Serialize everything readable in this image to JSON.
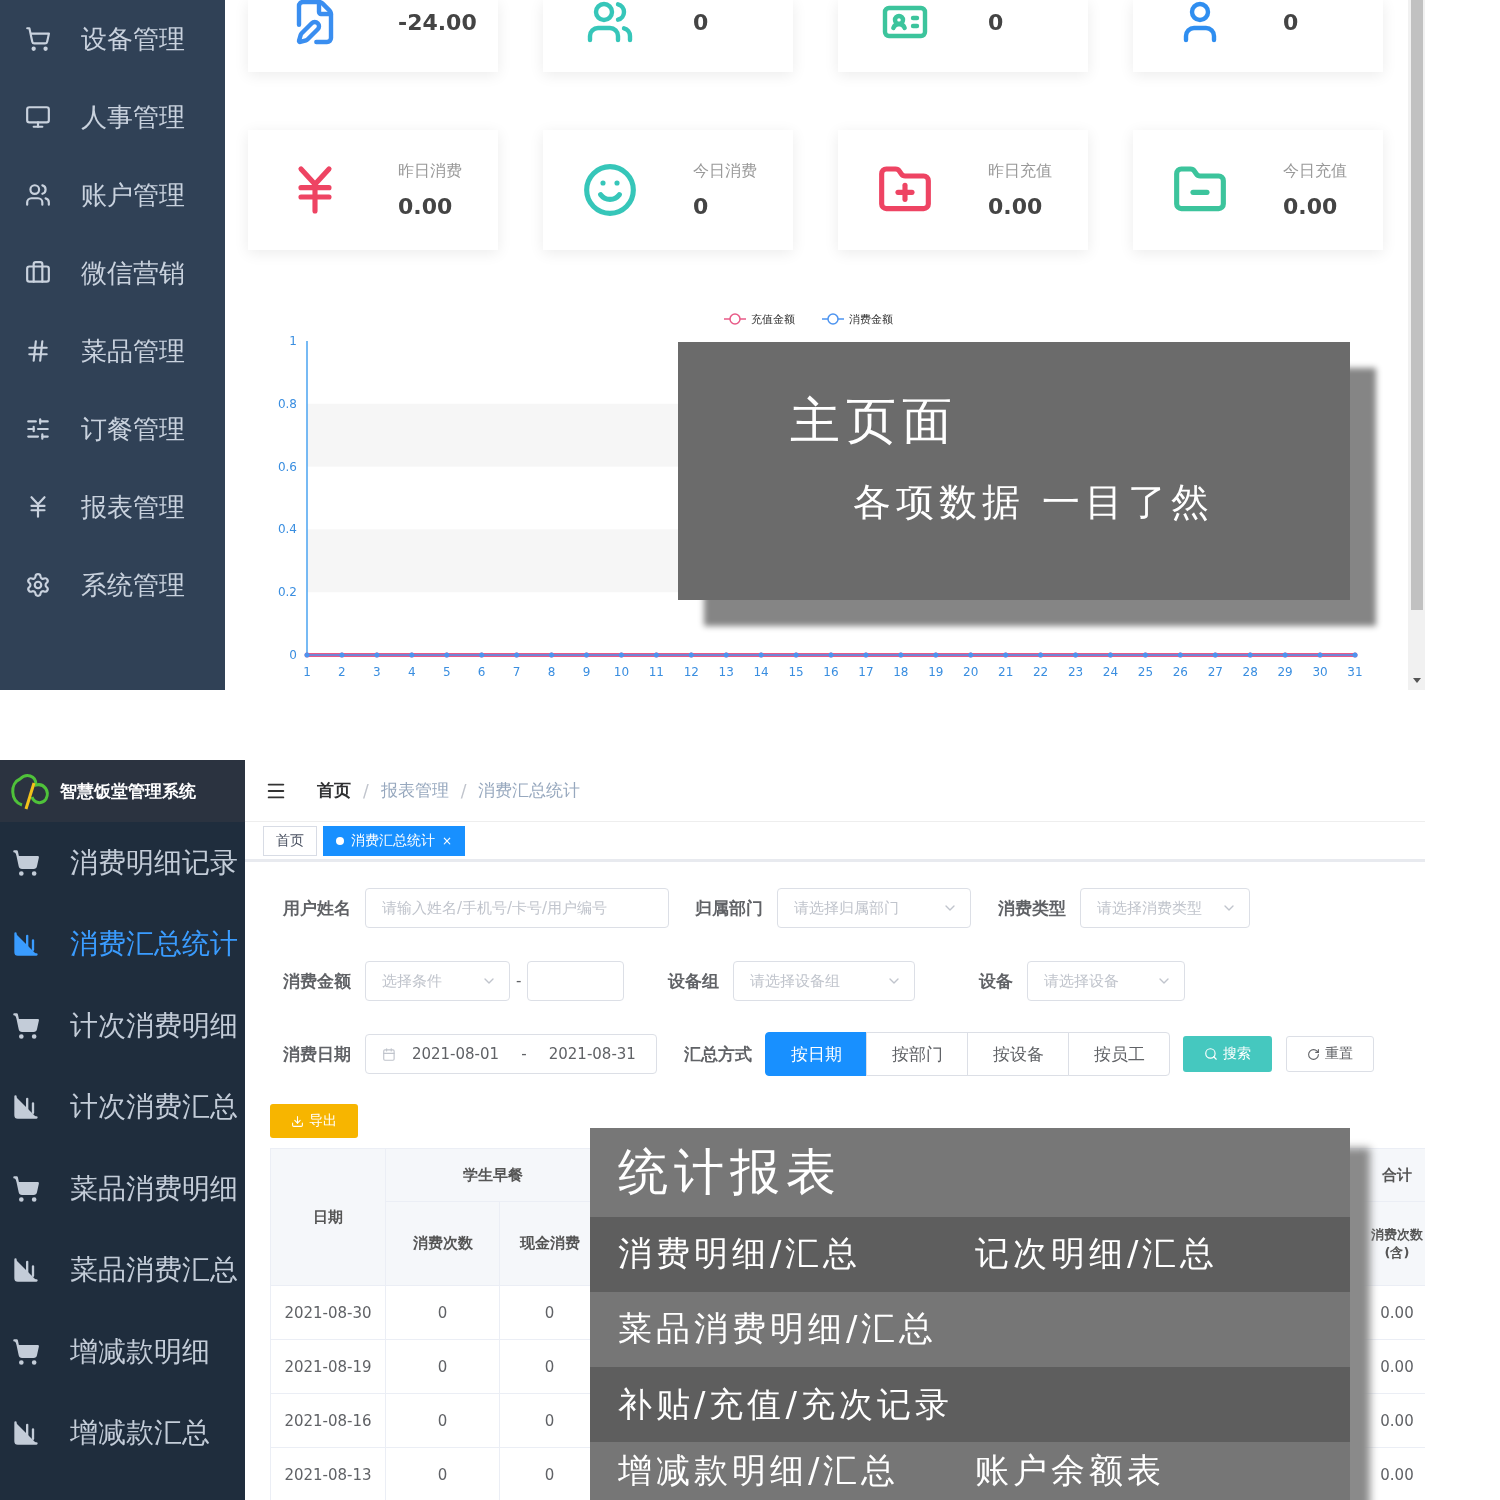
{
  "dashboard": {
    "sidebar": {
      "items": [
        "设备管理",
        "人事管理",
        "账户管理",
        "微信营销",
        "菜品管理",
        "订餐管理",
        "报表管理",
        "系统管理"
      ]
    },
    "stat_cards": [
      {
        "value": "-24.00"
      },
      {
        "value": "0"
      },
      {
        "value": "0"
      },
      {
        "value": "0"
      },
      {
        "label": "昨日消费",
        "value": "0.00"
      },
      {
        "label": "今日消费",
        "value": "0"
      },
      {
        "label": "昨日充值",
        "value": "0.00"
      },
      {
        "label": "今日充值",
        "value": "0.00"
      }
    ],
    "chart": {
      "chart_data": {
        "type": "line",
        "x": [
          1,
          2,
          3,
          4,
          5,
          6,
          7,
          8,
          9,
          10,
          11,
          12,
          13,
          14,
          15,
          16,
          17,
          18,
          19,
          20,
          21,
          22,
          23,
          24,
          25,
          26,
          27,
          28,
          29,
          30,
          31
        ],
        "xticks": [
          1,
          2,
          3,
          4,
          5,
          6,
          7,
          8,
          9,
          10,
          11,
          12,
          13,
          14,
          15,
          16,
          17,
          18,
          19,
          20,
          21,
          22,
          23,
          24,
          25,
          26,
          27,
          28,
          29,
          30,
          31
        ],
        "xlim": [
          1,
          31
        ],
        "ylim": [
          0,
          1
        ],
        "legend": true,
        "yticks": [
          0,
          0.2,
          0.4,
          0.6,
          0.8,
          1
        ],
        "series": [
          {
            "name": "充值金额",
            "color": "#e85a87",
            "values": [
              0,
              0,
              0,
              0,
              0,
              0,
              0,
              0,
              0,
              0,
              0,
              0,
              0,
              0,
              0,
              0,
              0,
              0,
              0,
              0,
              0,
              0,
              0,
              0,
              0,
              0,
              0,
              0,
              0,
              0,
              0
            ]
          },
          {
            "name": "消费金额",
            "color": "#4d94f0",
            "values": [
              0,
              0,
              0,
              0,
              0,
              0,
              0,
              0,
              0,
              0,
              0,
              0,
              0,
              0,
              0,
              0,
              0,
              0,
              0,
              0,
              0,
              0,
              0,
              0,
              0,
              0,
              0,
              0,
              0,
              0,
              0
            ]
          }
        ]
      }
    },
    "overlay": {
      "title": "主页面",
      "subtitle": "各项数据 一目了然"
    }
  },
  "report": {
    "app_title": "智慧饭堂管理系统",
    "sidebar": {
      "items": [
        {
          "label": "消费明细记录",
          "selected": false
        },
        {
          "label": "消费汇总统计",
          "selected": true
        },
        {
          "label": "计次消费明细",
          "selected": false
        },
        {
          "label": "计次消费汇总",
          "selected": false
        },
        {
          "label": "菜品消费明细",
          "selected": false
        },
        {
          "label": "菜品消费汇总",
          "selected": false
        },
        {
          "label": "增减款明细",
          "selected": false
        },
        {
          "label": "增减款汇总",
          "selected": false
        }
      ]
    },
    "breadcrumb": [
      {
        "label": "首页",
        "separator": "/"
      },
      {
        "label": "报表管理",
        "separator": "/"
      },
      {
        "label": "消费汇总统计"
      }
    ],
    "tabs": [
      {
        "label": "首页",
        "selected": false
      },
      {
        "label": "消费汇总统计",
        "selected": true,
        "close": "×"
      }
    ],
    "filters": [
      [
        {
          "kind": "text",
          "label": "用户姓名",
          "placeholder": "请输入姓名/手机号/卡号/用户编号"
        },
        {
          "kind": "select",
          "label": "归属部门",
          "placeholder": "请选择归属部门"
        },
        {
          "kind": "select",
          "label": "消费类型",
          "placeholder": "请选择消费类型"
        }
      ],
      [
        {
          "kind": "range",
          "label": "消费金额",
          "placeholder": "选择条件",
          "separator": "-"
        },
        {
          "kind": "select",
          "label": "设备组",
          "placeholder": "请选择设备组"
        },
        {
          "kind": "select",
          "label": "设备",
          "placeholder": "请选择设备"
        }
      ],
      [
        {
          "kind": "date",
          "label": "消费日期",
          "start": "2021-08-01",
          "separator": "-",
          "end": "2021-08-31"
        },
        {
          "kind": "segmented",
          "label": "汇总方式",
          "options": [
            {
              "label": "按日期",
              "selected": true
            },
            {
              "label": "按部门",
              "selected": false
            },
            {
              "label": "按设备",
              "selected": false
            },
            {
              "label": "按员工",
              "selected": false
            }
          ]
        }
      ]
    ],
    "search_button": "搜索",
    "reset_button": "重置",
    "export_button": "导出",
    "table": {
      "date_header": "日期",
      "group_header": "学生早餐",
      "sub_headers": [
        "消费次数",
        "现金消费"
      ],
      "total_header": "合计",
      "total_sub_header": "消费次数(含)",
      "rows": [
        {
          "date": "2021-08-30",
          "cells": [
            "0",
            "0"
          ],
          "total": "0.00"
        },
        {
          "date": "2021-08-19",
          "cells": [
            "0",
            "0"
          ],
          "total": "0.00"
        },
        {
          "date": "2021-08-16",
          "cells": [
            "0",
            "0"
          ],
          "total": "0.00"
        },
        {
          "date": "2021-08-13",
          "cells": [
            "0",
            "0"
          ],
          "total": "0.00"
        }
      ]
    },
    "overlay": {
      "title": "统计报表",
      "lines": [
        [
          "消费明细/汇总",
          "记次明细/汇总"
        ],
        [
          "菜品消费明细/汇总"
        ],
        [
          "补贴/充值/充次记录"
        ],
        [
          "增减款明细/汇总",
          "账户余额表"
        ]
      ]
    }
  }
}
